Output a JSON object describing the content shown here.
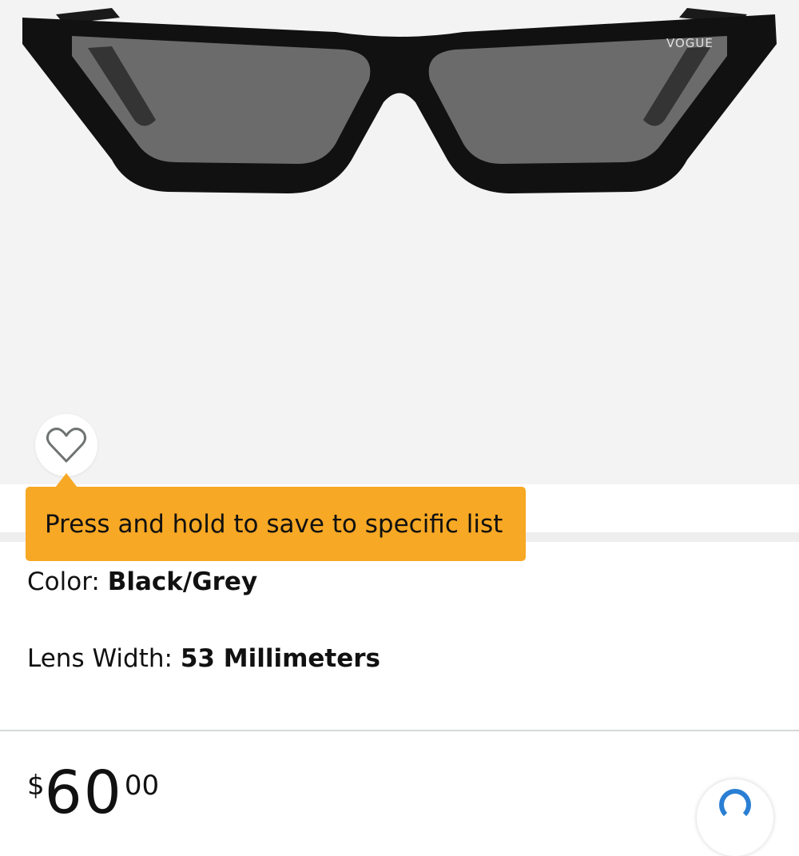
{
  "product": {
    "image_alt": "Black cat-eye sunglasses with grey lenses",
    "brand_mark": "VOGUE"
  },
  "wishlist": {
    "icon": "heart-outline-icon",
    "tooltip": "Press and hold to save to specific list"
  },
  "variations": {
    "color": {
      "label": "Color: ",
      "value": "Black/Grey"
    },
    "lens_width": {
      "label": "Lens Width: ",
      "value": "53 Millimeters"
    }
  },
  "price": {
    "symbol": "$",
    "whole": "60",
    "fraction": "00"
  },
  "colors": {
    "tooltip_bg": "#f7a824",
    "image_bg": "#f3f3f3",
    "accent_blue": "#2a7fd4"
  }
}
